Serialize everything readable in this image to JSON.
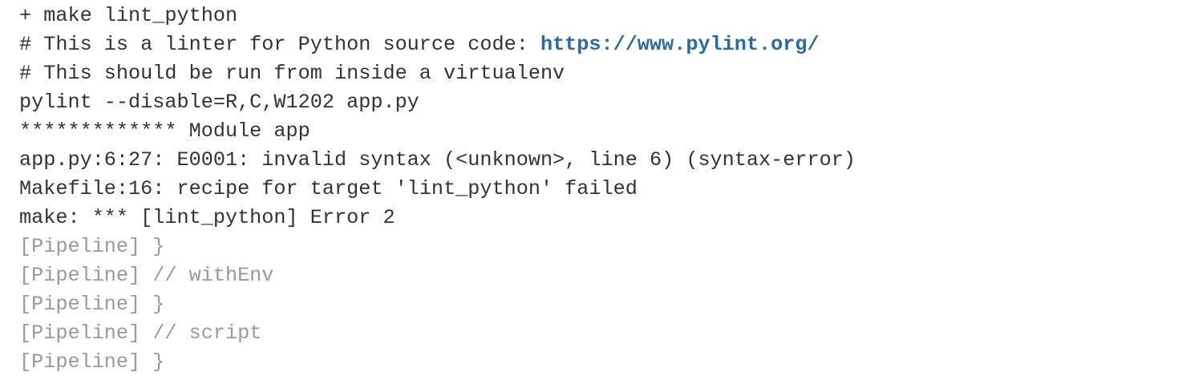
{
  "console": {
    "lines": [
      {
        "text": "+ make lint_python",
        "type": "normal"
      },
      {
        "text": "# This is a linter for Python source code: ",
        "link": "https://www.pylint.org/",
        "type": "normal"
      },
      {
        "text": "# This should be run from inside a virtualenv",
        "type": "normal"
      },
      {
        "text": "pylint --disable=R,C,W1202 app.py",
        "type": "normal"
      },
      {
        "text": "************* Module app",
        "type": "normal"
      },
      {
        "text": "app.py:6:27: E0001: invalid syntax (<unknown>, line 6) (syntax-error)",
        "type": "normal"
      },
      {
        "text": "Makefile:16: recipe for target 'lint_python' failed",
        "type": "normal"
      },
      {
        "text": "make: *** [lint_python] Error 2",
        "type": "normal"
      },
      {
        "text": "[Pipeline] }",
        "type": "pipeline"
      },
      {
        "text": "[Pipeline] // withEnv",
        "type": "pipeline"
      },
      {
        "text": "[Pipeline] }",
        "type": "pipeline"
      },
      {
        "text": "[Pipeline] // script",
        "type": "pipeline"
      },
      {
        "text": "[Pipeline] }",
        "type": "pipeline"
      }
    ]
  },
  "colors": {
    "text": "#333333",
    "pipeline": "#9a9a9a",
    "link": "#2b6aa6"
  }
}
